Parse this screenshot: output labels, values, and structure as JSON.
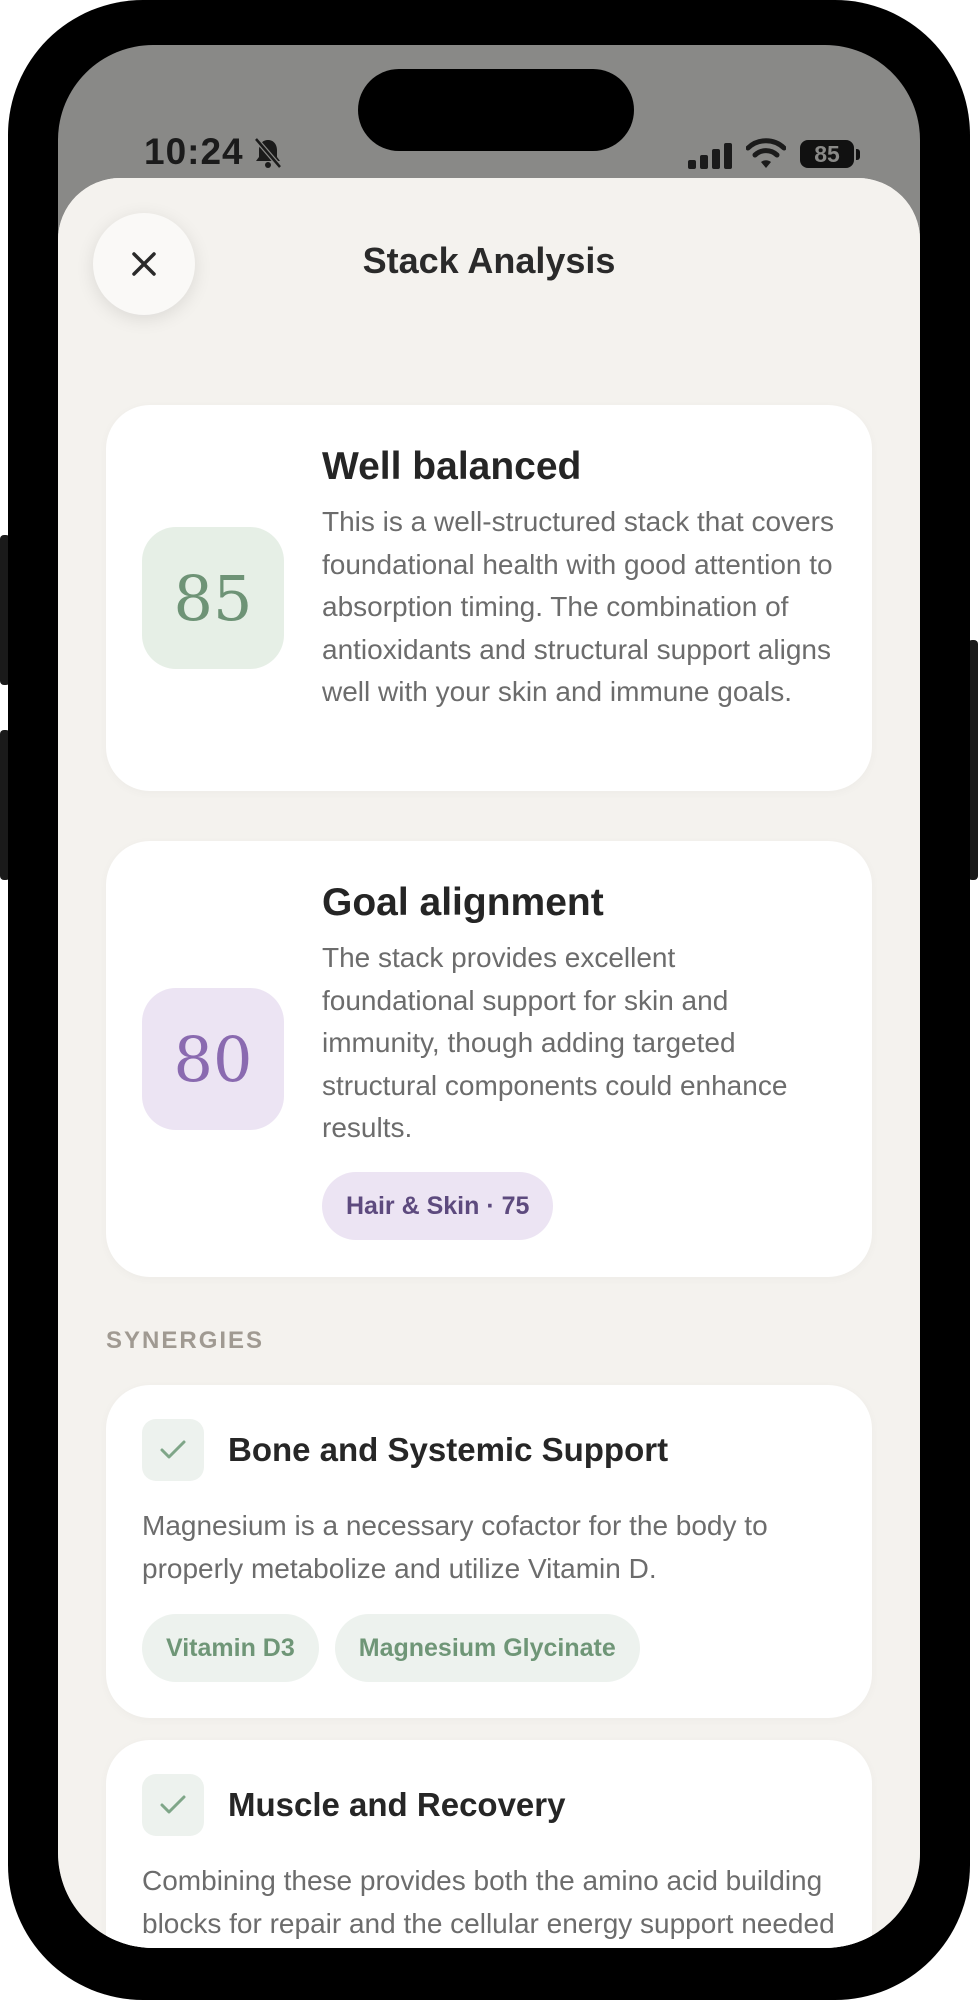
{
  "status_bar": {
    "time": "10:24",
    "battery": "85"
  },
  "header": {
    "title": "Stack Analysis"
  },
  "score_cards": [
    {
      "score": "85",
      "title": "Well balanced",
      "description": "This is a well-structured stack that covers foundational health with good attention to absorption timing. The combination of antioxidants and structural support aligns well with your skin and immune goals."
    },
    {
      "score": "80",
      "title": "Goal alignment",
      "description": "The stack provides excellent foundational support for skin and immunity, though adding targeted structural components could enhance results.",
      "goal_tag": "Hair & Skin · 75"
    }
  ],
  "synergies": {
    "label": "SYNERGIES",
    "items": [
      {
        "title": "Bone and Systemic Support",
        "description": "Magnesium is a necessary cofactor for the body to properly metabolize and utilize Vitamin D.",
        "tags": [
          "Vitamin D3",
          "Magnesium Glycinate"
        ]
      },
      {
        "title": "Muscle and Recovery",
        "description": "Combining these provides both the amino acid building blocks for repair and the cellular energy support needed for muscle function."
      }
    ]
  },
  "icons": {
    "close": "close-icon",
    "check": "check-icon",
    "bell_off": "bell-off-icon",
    "signal": "signal-icon",
    "wifi": "wifi-icon",
    "battery": "battery-icon"
  },
  "colors": {
    "sheet_background": "#f4f2ee",
    "score_green": "#6e9376",
    "score_purple": "#8a6ab0",
    "tag_green": "#6f9677"
  }
}
